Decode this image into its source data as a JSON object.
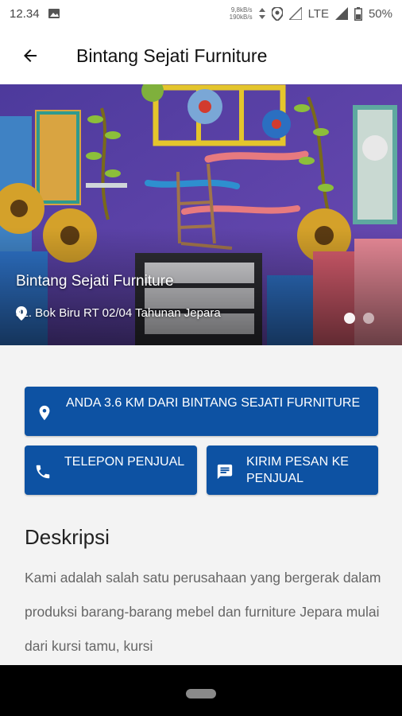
{
  "status_bar": {
    "time": "12.34",
    "net_speed_up": "9,8kB/s",
    "net_speed_down": "190kB/s",
    "network": "LTE",
    "battery": "50%"
  },
  "app_bar": {
    "back_icon": "arrow-left-icon",
    "title": "Bintang Sejati Furniture"
  },
  "hero": {
    "title": "Bintang Sejati Furniture",
    "address": "JL. Bok Biru RT 02/04 Tahunan Jepara",
    "location_icon": "location-pin-icon",
    "carousel_count": 2,
    "carousel_active": 0
  },
  "actions": {
    "distance": {
      "icon": "location-pin-icon",
      "label": "ANDA 3.6 KM DARI BINTANG SEJATI FURNITURE"
    },
    "call": {
      "icon": "phone-icon",
      "label": "TELEPON PENJUAL"
    },
    "message": {
      "icon": "message-icon",
      "label": "KIRIM PESAN KE PENJUAL"
    }
  },
  "description": {
    "heading": "Deskripsi",
    "text": "Kami adalah salah satu perusahaan yang bergerak dalam produksi barang-barang mebel dan furniture Jepara mulai dari kursi tamu, kursi"
  },
  "colors": {
    "primary": "#0d52a3",
    "background": "#f3f3f3"
  }
}
